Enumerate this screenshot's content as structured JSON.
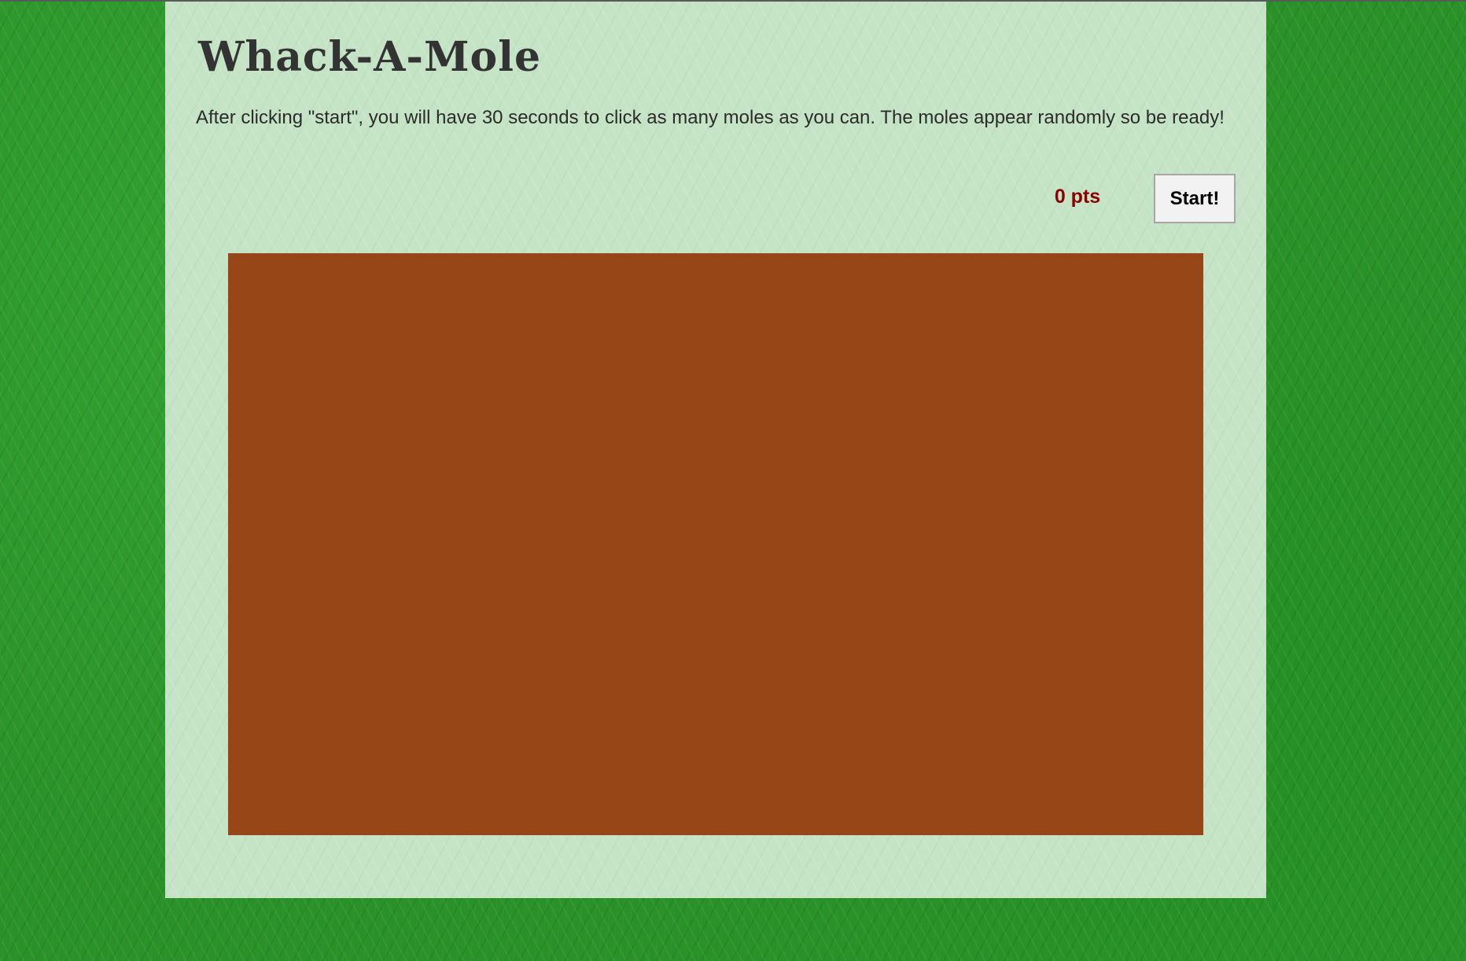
{
  "game": {
    "title": "Whack-A-Mole",
    "instructions": "After clicking \"start\", you will have 30 seconds to click as many moles as you can. The moles appear randomly so be ready!",
    "score_label": "0 pts",
    "start_label": "Start!"
  },
  "colors": {
    "grass": "#2a9129",
    "panel": "#c5e3c5",
    "dirt": "#974617",
    "score": "#8b0000",
    "title": "#333333"
  }
}
